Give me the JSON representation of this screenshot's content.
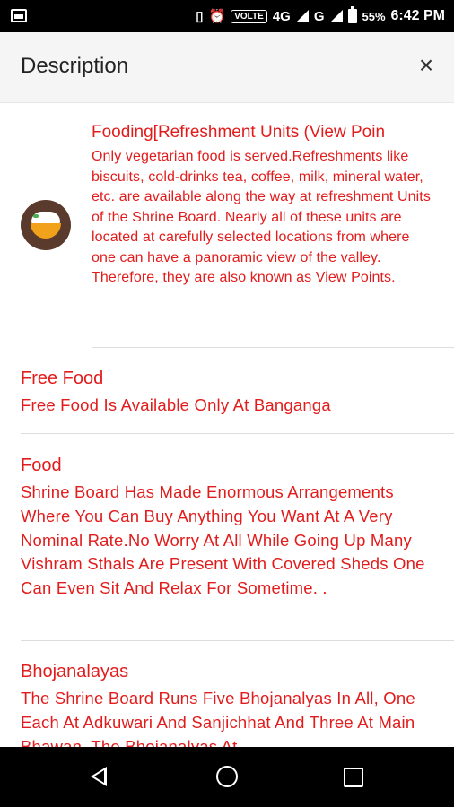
{
  "status_bar": {
    "volte": "VOLTE",
    "network": "4G",
    "network2": "G",
    "battery": "55%",
    "time": "6:42 PM"
  },
  "header": {
    "title": "Description",
    "close_label": "×"
  },
  "items": [
    {
      "title": "Fooding[Refreshment Units (View Poin",
      "body": "Only vegetarian food is served.Refreshments like biscuits, cold-drinks tea, coffee, milk, mineral water, etc. are available along the way at refreshment Units of the Shrine Board. Nearly all of these units are located at carefully selected locations from where one can have a panoramic view of the valley. Therefore, they are also known as View Points.",
      "icon": "food-bowl-icon"
    },
    {
      "title": "Free Food",
      "body": "Free Food Is Available Only At Banganga"
    },
    {
      "title": "Food",
      "body": "Shrine Board Has Made Enormous Arrangements Where You Can Buy Anything You Want At A Very Nominal Rate.No Worry At All While Going Up Many Vishram Sthals Are Present With Covered Sheds One Can Even Sit And Relax For Sometime. ."
    },
    {
      "title": "Bhojanalayas",
      "body": "The Shrine Board Runs Five Bhojanalyas In All, One Each At Adkuwari And Sanjichhat And Three At Main Bhawan. The Bhojanalyas At"
    }
  ],
  "colors": {
    "accent": "#e21c1c",
    "header_bg": "#f5f5f5",
    "icon_bg": "#5a3a2c",
    "bowl": "#f2a21a"
  }
}
